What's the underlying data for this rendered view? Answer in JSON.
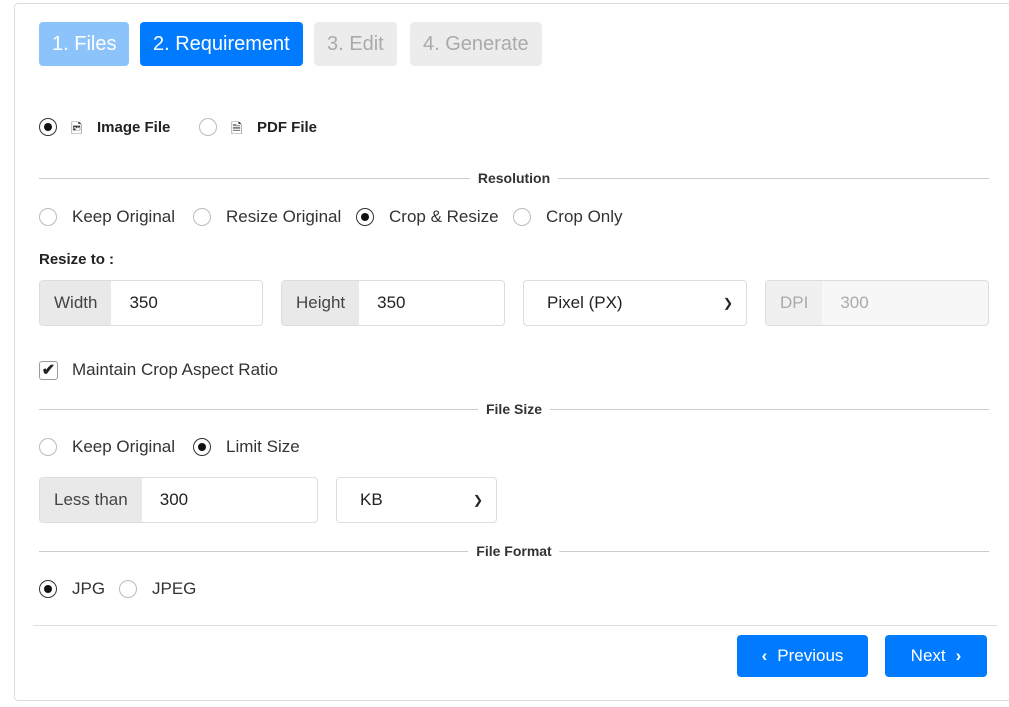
{
  "steps": [
    {
      "label": "1. Files",
      "state": "done"
    },
    {
      "label": "2. Requirement",
      "state": "active"
    },
    {
      "label": "3. Edit",
      "state": "disabled"
    },
    {
      "label": "4. Generate",
      "state": "disabled"
    }
  ],
  "file_type": {
    "options": [
      "Image File",
      "PDF File"
    ],
    "selected": "Image File"
  },
  "resolution": {
    "title": "Resolution",
    "options": [
      "Keep Original",
      "Resize Original",
      "Crop & Resize",
      "Crop Only"
    ],
    "selected": "Crop & Resize",
    "resize_label": "Resize to :",
    "width_label": "Width",
    "width": "350",
    "height_label": "Height",
    "height": "350",
    "unit": "Pixel (PX)",
    "dpi_label": "DPI",
    "dpi": "300",
    "maintain_label": "Maintain Crop Aspect Ratio",
    "maintain_checked": true
  },
  "file_size": {
    "title": "File Size",
    "options": [
      "Keep Original",
      "Limit Size"
    ],
    "selected": "Limit Size",
    "less_label": "Less than",
    "value": "300",
    "unit": "KB"
  },
  "file_format": {
    "title": "File Format",
    "options": [
      "JPG",
      "JPEG"
    ],
    "selected": "JPG"
  },
  "footer": {
    "previous": "Previous",
    "next": "Next"
  },
  "colors": {
    "primary": "#007bff",
    "done": "#80bdff",
    "disabled": "#e9ecef"
  }
}
